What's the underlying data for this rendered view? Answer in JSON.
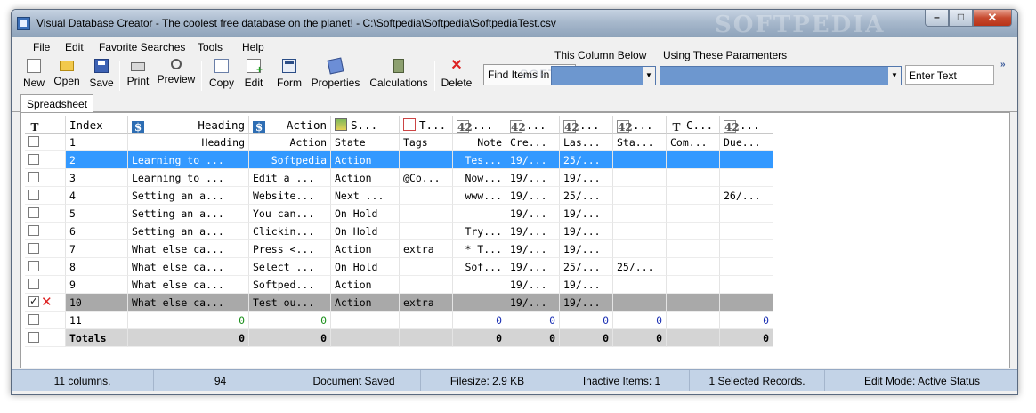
{
  "window": {
    "title": "Visual Database Creator - The coolest free database on the planet! - C:\\Softpedia\\Softpedia\\SoftpediaTest.csv",
    "watermark": "SOFTPEDIA"
  },
  "menu": [
    "File",
    "Edit",
    "Favorite Searches",
    "Tools",
    "Help"
  ],
  "toolbar": {
    "new": "New",
    "open": "Open",
    "save": "Save",
    "print": "Print",
    "preview": "Preview",
    "copy": "Copy",
    "edit": "Edit",
    "form": "Form",
    "properties": "Properties",
    "calculations": "Calculations",
    "delete": "Delete"
  },
  "search": {
    "find_label": "Find Items In",
    "find_watermark": "SOFTPEDIA",
    "column_below_label": "This Column Below",
    "using_label": "Using These Paramenters",
    "column_value": "",
    "parameter_value": "",
    "text_value": "Enter Text"
  },
  "tabs": [
    "Spreadsheet"
  ],
  "grid": {
    "columns": [
      {
        "label": "Index",
        "icon": "text-type-icon"
      },
      {
        "label": "Heading",
        "icon": "dollar-type-icon"
      },
      {
        "label": "Action",
        "icon": "dollar-type-icon"
      },
      {
        "label": "S...",
        "icon": "state-type-icon"
      },
      {
        "label": "T...",
        "icon": "tags-type-icon"
      },
      {
        "label": "...",
        "icon": "number-type-icon"
      },
      {
        "label": "...",
        "icon": "number-type-icon"
      },
      {
        "label": "...",
        "icon": "number-type-icon"
      },
      {
        "label": "...",
        "icon": "number-type-icon"
      },
      {
        "label": "C...",
        "icon": "text-type-icon"
      },
      {
        "label": "...",
        "icon": "number-type-icon"
      }
    ],
    "rows": [
      [
        "1",
        "Heading",
        "Action",
        "State",
        "Tags",
        "Note",
        "Cre...",
        "Las...",
        "Sta...",
        "Com...",
        "Due..."
      ],
      [
        "2",
        "Learning to ...",
        "Softpedia",
        "Action",
        "",
        "Tes...",
        "19/...",
        "25/...",
        "",
        "",
        ""
      ],
      [
        "3",
        "Learning to ...",
        "Edit a ...",
        "Action",
        "@Co...",
        "Now...",
        "19/...",
        "19/...",
        "",
        "",
        ""
      ],
      [
        "4",
        "Setting an a...",
        "Website...",
        "Next ...",
        "",
        "www...",
        "19/...",
        "25/...",
        "",
        "",
        "26/..."
      ],
      [
        "5",
        "Setting an a...",
        "You can...",
        "On Hold",
        "",
        "",
        "19/...",
        "19/...",
        "",
        "",
        ""
      ],
      [
        "6",
        "Setting an a...",
        "Clickin...",
        "On Hold",
        "",
        "Try...",
        "19/...",
        "19/...",
        "",
        "",
        ""
      ],
      [
        "7",
        "What else ca...",
        "Press <...",
        "Action",
        "extra",
        "* T...",
        "19/...",
        "19/...",
        "",
        "",
        ""
      ],
      [
        "8",
        "What else ca...",
        "Select ...",
        "On Hold",
        "",
        "Sof...",
        "19/...",
        "25/...",
        "25/...",
        "",
        ""
      ],
      [
        "9",
        "What else ca...",
        "Softped...",
        "Action",
        "",
        "",
        "19/...",
        "19/...",
        "",
        "",
        ""
      ],
      [
        "10",
        "What else ca...",
        "Test ou...",
        "Action",
        "extra",
        "",
        "19/...",
        "19/...",
        "",
        "",
        ""
      ]
    ],
    "sum_row": [
      "11",
      "0",
      "0",
      "",
      "",
      "0",
      "0",
      "0",
      "0",
      "",
      "0"
    ],
    "totals_row": [
      "Totals",
      "0",
      "0",
      "",
      "",
      "0",
      "0",
      "0",
      "0",
      "",
      "0"
    ]
  },
  "status": [
    "11 columns.",
    "94",
    "Document Saved",
    "Filesize: 2.9 KB",
    "Inactive Items: 1",
    "1 Selected Records.",
    "Edit Mode: Active Status"
  ],
  "colors": {
    "selection": "#3399ff",
    "focused_row": "#a9a9a9",
    "statusbar": "#c3d3e7",
    "dropdown": "#6d97cf"
  }
}
